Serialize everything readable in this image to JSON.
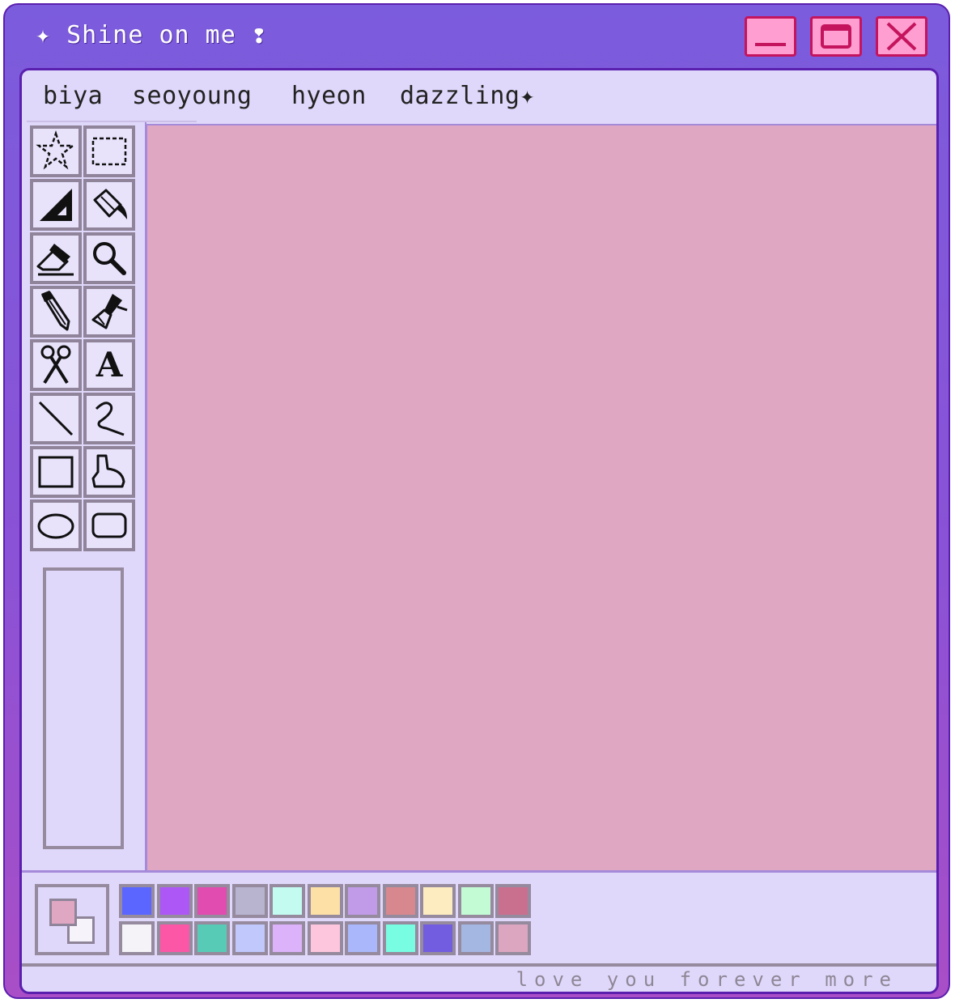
{
  "window": {
    "title": "✦ Shine on me ❢",
    "buttons": [
      "minimize",
      "maximize",
      "close"
    ]
  },
  "menu": {
    "items": [
      "biya",
      "seoyoung",
      "hyeon",
      "dazzling✦"
    ]
  },
  "tools": [
    {
      "name": "free-select",
      "icon": "star-select-icon"
    },
    {
      "name": "rect-select",
      "icon": "dashed-rect-icon"
    },
    {
      "name": "triangle",
      "icon": "triangle-ruler-icon"
    },
    {
      "name": "fill",
      "icon": "paint-bucket-icon"
    },
    {
      "name": "eraser",
      "icon": "eraser-icon"
    },
    {
      "name": "magnifier",
      "icon": "magnifier-icon"
    },
    {
      "name": "pencil",
      "icon": "pencil-icon"
    },
    {
      "name": "brush",
      "icon": "brush-icon"
    },
    {
      "name": "scissors",
      "icon": "scissors-icon"
    },
    {
      "name": "text",
      "icon": "text-icon",
      "glyph": "A"
    },
    {
      "name": "line",
      "icon": "line-icon"
    },
    {
      "name": "curve",
      "icon": "curve-icon"
    },
    {
      "name": "rectangle",
      "icon": "rectangle-icon"
    },
    {
      "name": "polygon",
      "icon": "polygon-icon"
    },
    {
      "name": "ellipse",
      "icon": "ellipse-icon"
    },
    {
      "name": "rounded-rect",
      "icon": "rounded-rect-icon"
    }
  ],
  "colors": {
    "canvas": "#e0a7c2",
    "foreground": "#e0a7c2",
    "background": "#f6f4fa",
    "palette_row1": [
      "#5a66ff",
      "#ad57f7",
      "#e04cb0",
      "#b8b3cf",
      "#c3fbf0",
      "#fde0a6",
      "#c19be8",
      "#d6888e",
      "#fdecc0",
      "#c2fbd4",
      "#c9708f"
    ],
    "palette_row2": [
      "#f5f3f8",
      "#fc57a7",
      "#58cbb7",
      "#c1c8fc",
      "#dcb2fa",
      "#fdc6dc",
      "#aab7fb",
      "#78fde3",
      "#725ce0",
      "#a4b6e2",
      "#dca6c1"
    ]
  },
  "status": {
    "text": "love you forever more"
  }
}
